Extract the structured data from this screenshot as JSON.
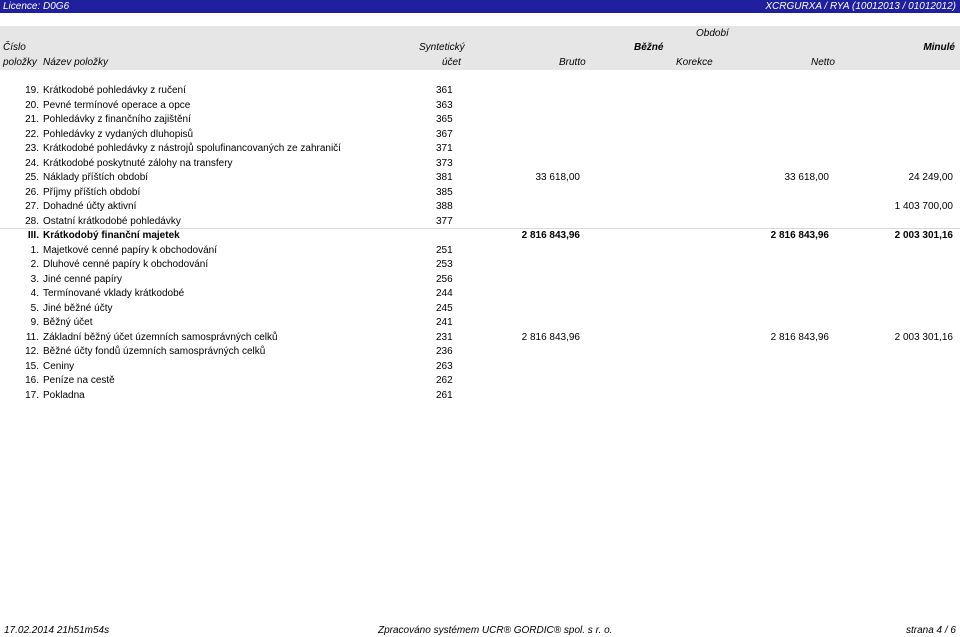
{
  "topbar": {
    "license": "Licence: D0G6",
    "id": "XCRGURXA / RYA (10012013 / 01012012)"
  },
  "header": {
    "cislo": "Číslo",
    "polozky": "položky",
    "nazev": "Název položky",
    "synteticky": "Syntetický",
    "ucet": "účet",
    "obdobi": "Období",
    "bezne": "Běžné",
    "minule": "Minulé",
    "brutto": "Brutto",
    "korekce": "Korekce",
    "netto": "Netto"
  },
  "rows": [
    {
      "num": "19.",
      "name": "Krátkodobé pohledávky z ručení",
      "acc": "361",
      "brutto": "",
      "netto": "",
      "minule": "",
      "bold": false
    },
    {
      "num": "20.",
      "name": "Pevné termínové operace a opce",
      "acc": "363",
      "brutto": "",
      "netto": "",
      "minule": "",
      "bold": false
    },
    {
      "num": "21.",
      "name": "Pohledávky z finančního zajištění",
      "acc": "365",
      "brutto": "",
      "netto": "",
      "minule": "",
      "bold": false
    },
    {
      "num": "22.",
      "name": "Pohledávky z vydaných dluhopisů",
      "acc": "367",
      "brutto": "",
      "netto": "",
      "minule": "",
      "bold": false
    },
    {
      "num": "23.",
      "name": "Krátkodobé pohledávky z nástrojů spolufinancovaných ze zahraničí",
      "acc": "371",
      "brutto": "",
      "netto": "",
      "minule": "",
      "bold": false
    },
    {
      "num": "24.",
      "name": "Krátkodobé poskytnuté zálohy na transfery",
      "acc": "373",
      "brutto": "",
      "netto": "",
      "minule": "",
      "bold": false
    },
    {
      "num": "25.",
      "name": "Náklady příštích období",
      "acc": "381",
      "brutto": "33 618,00",
      "netto": "33 618,00",
      "minule": "24 249,00",
      "bold": false
    },
    {
      "num": "26.",
      "name": "Příjmy příštích období",
      "acc": "385",
      "brutto": "",
      "netto": "",
      "minule": "",
      "bold": false
    },
    {
      "num": "27.",
      "name": "Dohadné účty aktivní",
      "acc": "388",
      "brutto": "",
      "netto": "",
      "minule": "1 403 700,00",
      "bold": false
    },
    {
      "num": "28.",
      "name": "Ostatní krátkodobé pohledávky",
      "acc": "377",
      "brutto": "",
      "netto": "",
      "minule": "",
      "bold": false
    },
    {
      "num": "III.",
      "name": "Krátkodobý finanční majetek",
      "acc": "",
      "brutto": "2 816 843,96",
      "netto": "2 816 843,96",
      "minule": "2 003 301,16",
      "bold": true
    },
    {
      "num": "1.",
      "name": "Majetkové cenné papíry k obchodování",
      "acc": "251",
      "brutto": "",
      "netto": "",
      "minule": "",
      "bold": false
    },
    {
      "num": "2.",
      "name": "Dluhové cenné papíry k obchodování",
      "acc": "253",
      "brutto": "",
      "netto": "",
      "minule": "",
      "bold": false
    },
    {
      "num": "3.",
      "name": "Jiné cenné papíry",
      "acc": "256",
      "brutto": "",
      "netto": "",
      "minule": "",
      "bold": false
    },
    {
      "num": "4.",
      "name": "Termínované vklady krátkodobé",
      "acc": "244",
      "brutto": "",
      "netto": "",
      "minule": "",
      "bold": false
    },
    {
      "num": "5.",
      "name": "Jiné běžné účty",
      "acc": "245",
      "brutto": "",
      "netto": "",
      "minule": "",
      "bold": false
    },
    {
      "num": "9.",
      "name": "Běžný účet",
      "acc": "241",
      "brutto": "",
      "netto": "",
      "minule": "",
      "bold": false
    },
    {
      "num": "11.",
      "name": "Základní běžný účet územních samosprávných celků",
      "acc": "231",
      "brutto": "2 816 843,96",
      "netto": "2 816 843,96",
      "minule": "2 003 301,16",
      "bold": false
    },
    {
      "num": "12.",
      "name": "Běžné účty fondů územních samosprávných celků",
      "acc": "236",
      "brutto": "",
      "netto": "",
      "minule": "",
      "bold": false
    },
    {
      "num": "15.",
      "name": "Ceniny",
      "acc": "263",
      "brutto": "",
      "netto": "",
      "minule": "",
      "bold": false
    },
    {
      "num": "16.",
      "name": "Peníze na cestě",
      "acc": "262",
      "brutto": "",
      "netto": "",
      "minule": "",
      "bold": false
    },
    {
      "num": "17.",
      "name": "Pokladna",
      "acc": "261",
      "brutto": "",
      "netto": "",
      "minule": "",
      "bold": false
    }
  ],
  "footer": {
    "timestamp": "17.02.2014 21h51m54s",
    "processed": "Zpracováno systémem UCR® GORDIC® spol. s r. o.",
    "page": "strana 4 / 6"
  }
}
